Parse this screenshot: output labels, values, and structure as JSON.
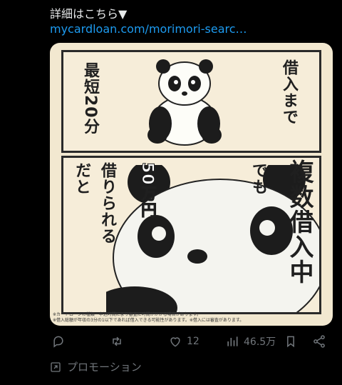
{
  "post": {
    "headline": "詳細はこちら▼",
    "link": "mycardloan.com/morimori-searc…"
  },
  "ad": {
    "top_left": "最短20分",
    "top_right": "借入まで",
    "bottom_left": "だと",
    "bottom_mid_left": "借りられる",
    "bottom_mid_amount": "50万円",
    "bottom_mid_right": "でも",
    "bottom_right": "複数借入中",
    "note1": "※カードローンの種類・申込時間により審査に時間がかかる場合があります。",
    "note2": "※借入総額が年収の3分の1以下であれば借入できる可能性があります。※借入には審査があります。"
  },
  "actions": {
    "reply": "",
    "repost": "",
    "likes": "12",
    "views": "46.5万",
    "bookmark": "",
    "share": ""
  },
  "promo": {
    "label": "プロモーション"
  }
}
